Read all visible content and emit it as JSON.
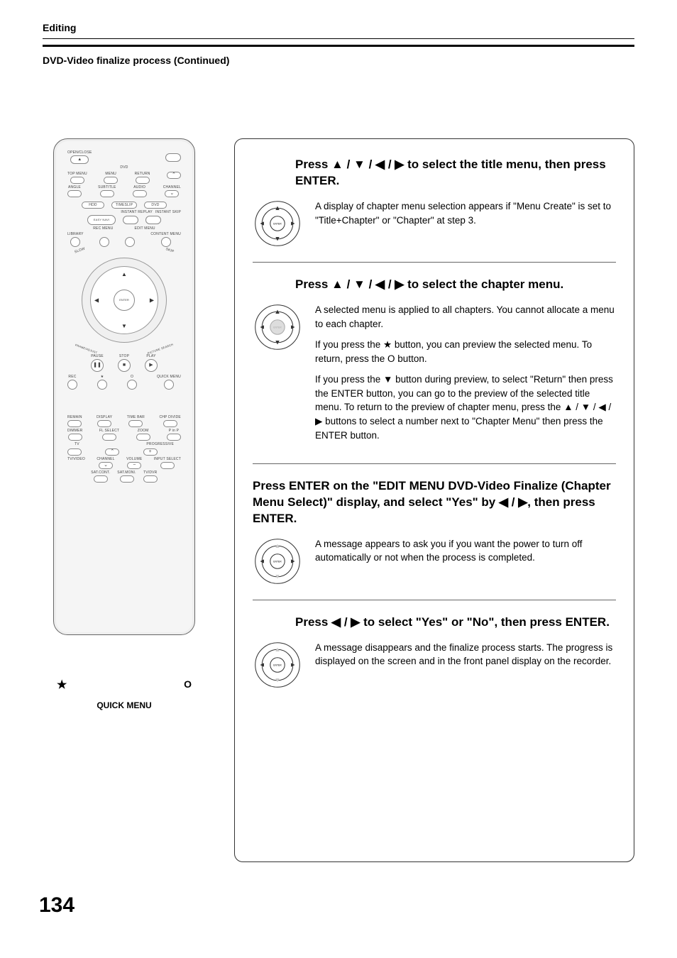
{
  "header": {
    "section": "Editing",
    "subsection": "DVD-Video finalize process (Continued)"
  },
  "remote": {
    "open_close": "OPEN/CLOSE",
    "dvd": "DVD",
    "top_menu": "TOP MENU",
    "menu": "MENU",
    "return": "RETURN",
    "angle": "ANGLE",
    "subtitle": "SUBTITLE",
    "audio": "AUDIO",
    "channel": "CHANNEL",
    "hdd": "HDD",
    "timeslip": "TIMESLIP",
    "dvd2": "DVD",
    "instant_replay": "INSTANT REPLAY",
    "instant_skip": "INSTANT SKIP",
    "easy_navi": "EASY NAVI",
    "rec_menu": "REC MENU",
    "edit_menu": "EDIT MENU",
    "library": "LIBRARY",
    "content_menu": "CONTENT MENU",
    "slow": "SLOW",
    "skip": "SKIP",
    "enter": "ENTER",
    "frame_adjust": "FRAME/ADJUST",
    "picture_search": "PICTURE SEARCH",
    "pause": "PAUSE",
    "stop": "STOP",
    "play": "PLAY",
    "rec": "REC",
    "star": "★",
    "o": "O",
    "quick_menu": "QUICK MENU",
    "remain": "REMAIN",
    "display": "DISPLAY",
    "time_bar": "TIME BAR",
    "chp_divide": "CHP DIVIDE",
    "dimmer": "DIMMER",
    "fl_select": "FL SELECT",
    "zoom": "ZOOM",
    "p_in_p": "P in P",
    "tv": "TV",
    "progressive": "PROGRESSIVE",
    "tv_video": "TV/VIDEO",
    "channel2": "CHANNEL",
    "volume": "VOLUME",
    "input_select": "INPUT SELECT",
    "sat_cont": "SAT.CONT.",
    "sat_moni": "SAT.MONI.",
    "tv_dvr": "TV/DVR"
  },
  "callouts": {
    "star": "★",
    "ring": "O",
    "quick_menu": "QUICK MENU"
  },
  "steps": [
    {
      "title_prefix": "Press ",
      "title_arrows": "▲ / ▼ / ◀ / ▶",
      "title_suffix": " to select the title menu, then press ENTER.",
      "dpad_variant": "full",
      "paragraphs": [
        "A display of chapter menu selection appears if \"Menu Create\" is set to \"Title+Chapter\" or \"Chapter\" at step 3."
      ]
    },
    {
      "title_prefix": "Press ",
      "title_arrows": "▲ / ▼ / ◀ / ▶",
      "title_suffix": " to select the chapter menu.",
      "dpad_variant": "full-grey-center",
      "paragraphs": [
        "A selected menu is applied to all chapters. You cannot allocate a menu to each chapter.",
        "If you press the ★ button, you can preview the selected menu. To return, press the O button.",
        "If you press the ▼ button during preview, to select \"Return\" then press the ENTER button, you can go to the preview of the selected title menu. To return to the preview of chapter menu, press the ▲ / ▼ / ◀ / ▶ buttons to select a number next to \"Chapter Menu\" then press the ENTER button."
      ]
    },
    {
      "title_full": "Press ENTER on the \"EDIT MENU DVD-Video Finalize (Chapter Menu Select)\" display, and select \"Yes\" by ◀ / ▶, then press ENTER.",
      "dpad_variant": "lr-enter",
      "paragraphs": [
        "A message appears to ask you if you want the power to turn off automatically or not when the process is completed."
      ],
      "head_margin": "none"
    },
    {
      "title_prefix": "Press ",
      "title_arrows": "◀ / ▶",
      "title_suffix": " to select \"Yes\" or \"No\", then press ENTER.",
      "dpad_variant": "lr-enter",
      "paragraphs": [
        "A message disappears and the finalize process starts. The progress is displayed on the screen and in the front panel display on the recorder."
      ]
    }
  ],
  "page_number": "134",
  "dpad_label": "ENTER"
}
